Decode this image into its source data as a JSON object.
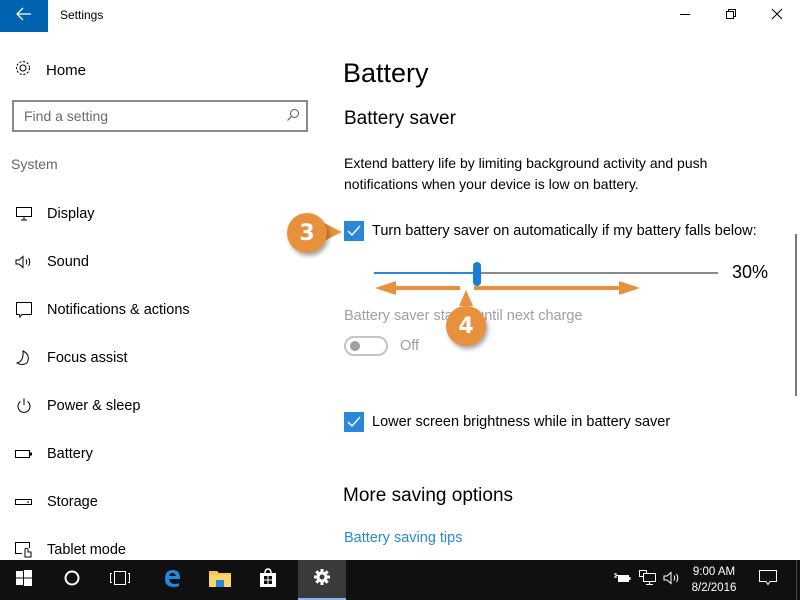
{
  "window": {
    "title": "Settings",
    "controls": [
      "minimize",
      "restore",
      "close"
    ]
  },
  "sidebar": {
    "home_label": "Home",
    "search": {
      "placeholder": "Find a setting",
      "value": ""
    },
    "group_label": "System",
    "items": [
      {
        "label": "Display",
        "icon": "display-icon"
      },
      {
        "label": "Sound",
        "icon": "speaker-icon"
      },
      {
        "label": "Notifications & actions",
        "icon": "notification-icon"
      },
      {
        "label": "Focus assist",
        "icon": "moon-icon"
      },
      {
        "label": "Power & sleep",
        "icon": "power-icon"
      },
      {
        "label": "Battery",
        "icon": "battery-icon"
      },
      {
        "label": "Storage",
        "icon": "storage-icon"
      },
      {
        "label": "Tablet mode",
        "icon": "tablet-mode-icon"
      }
    ]
  },
  "main": {
    "page_title": "Battery",
    "section_title": "Battery saver",
    "description": "Extend battery life by limiting background activity and push notifications when your device is low on battery.",
    "auto_checkbox": {
      "label": "Turn battery saver on automatically if my battery falls below:",
      "checked": true
    },
    "threshold_slider": {
      "value_percent": 30,
      "display": "30%"
    },
    "status_label": "Battery saver status until next charge",
    "status_toggle": {
      "state": "Off",
      "enabled": false
    },
    "brightness_checkbox": {
      "label": "Lower screen brightness while in battery saver",
      "checked": true
    },
    "more_title": "More saving options",
    "tips_link": "Battery saving tips"
  },
  "callouts": [
    {
      "number": "3"
    },
    {
      "number": "4"
    }
  ],
  "colors": {
    "accent": "#2b88d8",
    "titlebar_back": "#0063b1",
    "callout": "#e8913c",
    "taskbar": "#101010"
  },
  "taskbar": {
    "buttons": [
      "start",
      "cortana",
      "task-view",
      "edge",
      "file-explorer",
      "store",
      "settings"
    ],
    "active": "settings",
    "clock": {
      "time": "9:00 AM",
      "date": "8/2/2016"
    }
  }
}
